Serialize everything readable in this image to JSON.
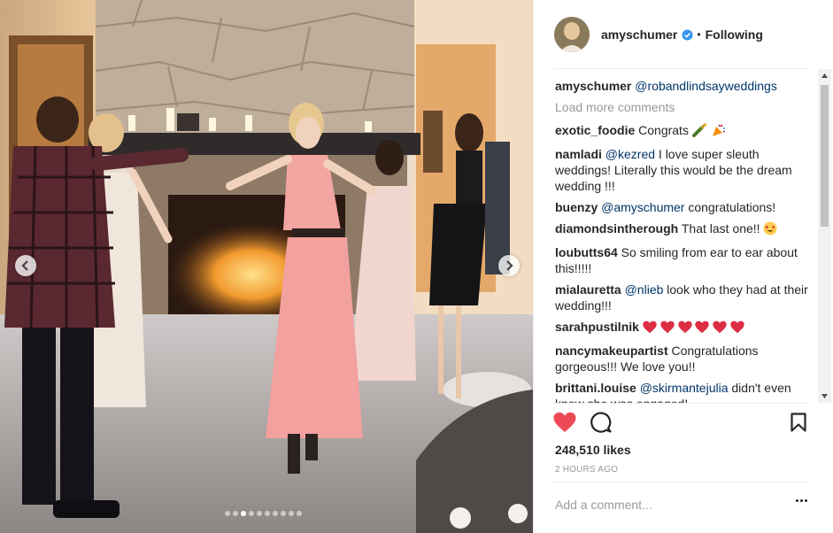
{
  "post": {
    "username": "amyschumer",
    "follow_separator": "•",
    "follow_label": "Following",
    "carousel": {
      "slide_count": 10,
      "active_slide": 3
    }
  },
  "caption": {
    "user": "amyschumer",
    "mention": "@robandlindsayweddings"
  },
  "load_more": "Load more comments",
  "comments": [
    {
      "user": "exotic_foodie",
      "text": "Congrats",
      "emojis": [
        "champagne-icon",
        "party-popper-icon"
      ]
    },
    {
      "user": "namladi",
      "mention": "@kezred",
      "text": "I love super sleuth weddings! Literally this would be the dream wedding !!!"
    },
    {
      "user": "buenzy",
      "mention": "@amyschumer",
      "text": "congratulations!"
    },
    {
      "user": "diamondsintherough",
      "text": "That last one!!",
      "emojis": [
        "heart-eyes-icon"
      ]
    },
    {
      "user": "loubutts64",
      "text": "So smiling from ear to ear about this!!!!!"
    },
    {
      "user": "mialauretta",
      "mention": "@nlieb",
      "text": "look who they had at their wedding!!!"
    },
    {
      "user": "sarahpustilnik",
      "text": "",
      "emojis": [
        "red-heart-icon",
        "red-heart-icon",
        "red-heart-icon",
        "red-heart-icon",
        "red-heart-icon",
        "red-heart-icon"
      ]
    },
    {
      "user": "nancymakeupartist",
      "text": "Congratulations gorgeous!!! We love you!!"
    },
    {
      "user": "brittani.louise",
      "mention": "@skirmantejulia",
      "text": "didn't even know she was engaged!"
    }
  ],
  "likes": "248,510 likes",
  "time": "2 HOURS AGO",
  "add_comment_placeholder": "Add a comment...",
  "colors": {
    "heart": "#ed4956",
    "mention": "#003569",
    "verified": "#3897f0"
  }
}
